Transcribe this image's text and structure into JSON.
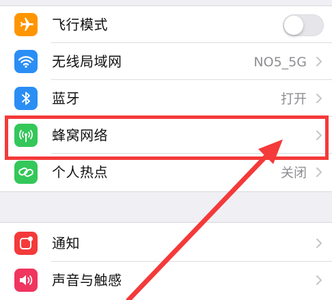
{
  "settings": {
    "rows": [
      {
        "label": "飞行模式",
        "icon": "airplane-icon",
        "color": "#ff9500",
        "control": "toggle",
        "toggle_on": false
      },
      {
        "label": "无线局域网",
        "icon": "wifi-icon",
        "color": "#2a8ef5",
        "value": "NO5_5G"
      },
      {
        "label": "蓝牙",
        "icon": "bluetooth-icon",
        "color": "#2a8ef5",
        "value": "打开"
      },
      {
        "label": "蜂窝网络",
        "icon": "cellular-antenna-icon",
        "color": "#34c759"
      },
      {
        "label": "个人热点",
        "icon": "hotspot-link-icon",
        "color": "#34c759",
        "value": "关闭"
      },
      {
        "label": "通知",
        "icon": "notification-icon",
        "color": "#f43a3a"
      },
      {
        "label": "声音与触感",
        "icon": "speaker-icon",
        "color": "#f0355f"
      }
    ]
  },
  "annotation": {
    "highlight_color": "#f43a3a",
    "arrow_color": "#f43a3a",
    "highlighted_row": "蜂窝网络"
  }
}
